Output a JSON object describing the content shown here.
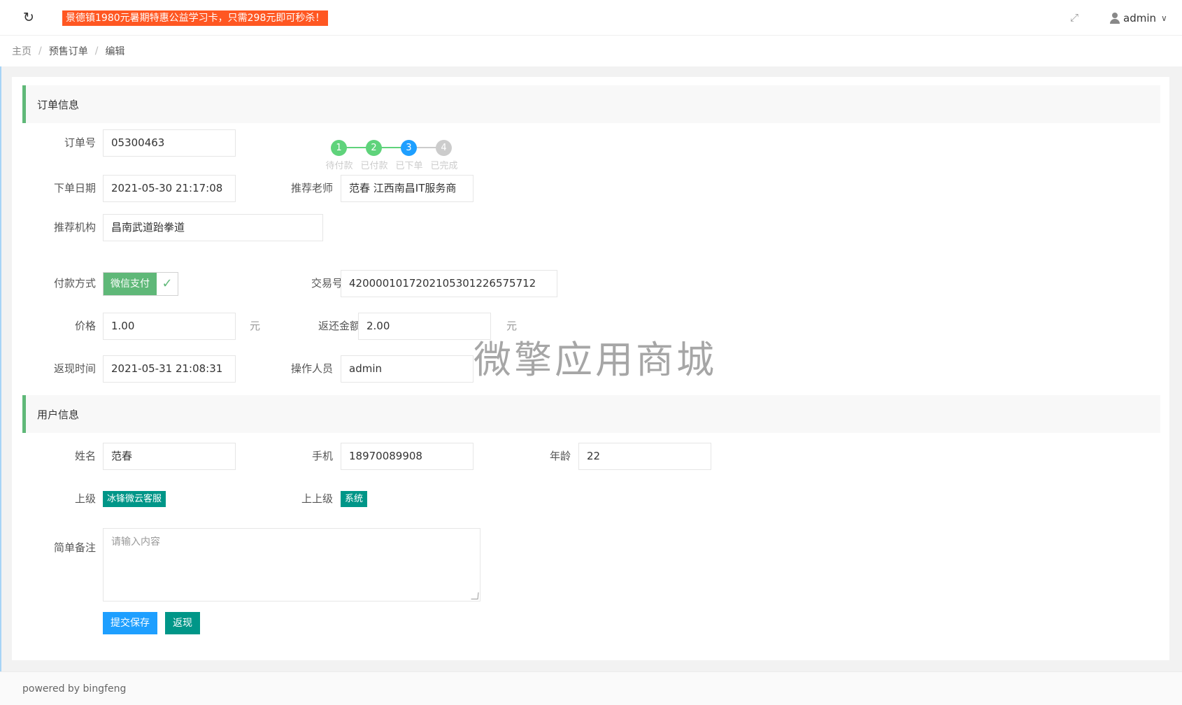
{
  "topbar": {
    "refresh_icon": "refresh-icon",
    "notice": "景德镇1980元暑期特惠公益学习卡，只需298元即可秒杀！",
    "fullscreen_icon": "fullscreen-icon",
    "user_name": "admin"
  },
  "breadcrumb": [
    "主页",
    "预售订单",
    "编辑"
  ],
  "order_section": {
    "title": "订单信息",
    "order_no_label": "订单号",
    "order_no": "05300463",
    "steps": [
      {
        "num": "1",
        "label": "待付款",
        "state": "done",
        "color": "#5fd37b"
      },
      {
        "num": "2",
        "label": "已付款",
        "state": "done",
        "color": "#5fd37b"
      },
      {
        "num": "3",
        "label": "已下单",
        "state": "current",
        "color": "#1e9fff"
      },
      {
        "num": "4",
        "label": "已完成",
        "state": "todo",
        "color": "#cccccc"
      }
    ],
    "date_label": "下单日期",
    "date": "2021-05-30 21:17:08",
    "teacher_label": "推荐老师",
    "teacher": "范春 江西南昌IT服务商",
    "org_label": "推荐机构",
    "org": "昌南武道跆拳道",
    "pay_label": "付款方式",
    "pay_method": "微信支付",
    "trade_label": "交易号",
    "trade_no": "4200001017202105301226575712",
    "price_label": "价格",
    "price": "1.00",
    "unit": "元",
    "refund_label": "返还金额",
    "refund": "2.00",
    "cash_time_label": "返现时间",
    "cash_time": "2021-05-31 21:08:31",
    "operator_label": "操作人员",
    "operator": "admin"
  },
  "user_section": {
    "title": "用户信息",
    "name_label": "姓名",
    "name": "范春",
    "phone_label": "手机",
    "phone": "18970089908",
    "age_label": "年龄",
    "age": "22",
    "parent_label": "上级",
    "parent": "冰锋微云客服",
    "grandparent_label": "上上级",
    "grandparent": "系统",
    "remark_label": "简单备注",
    "remark_placeholder": "请输入内容"
  },
  "buttons": {
    "save": "提交保存",
    "cash": "返现"
  },
  "watermark": "微擎应用商城",
  "footer": "powered by bingfeng",
  "colors": {
    "accent_green": "#5fb878",
    "accent_blue": "#1e9fff",
    "teal": "#009688",
    "notice_bg": "#ff5722"
  }
}
